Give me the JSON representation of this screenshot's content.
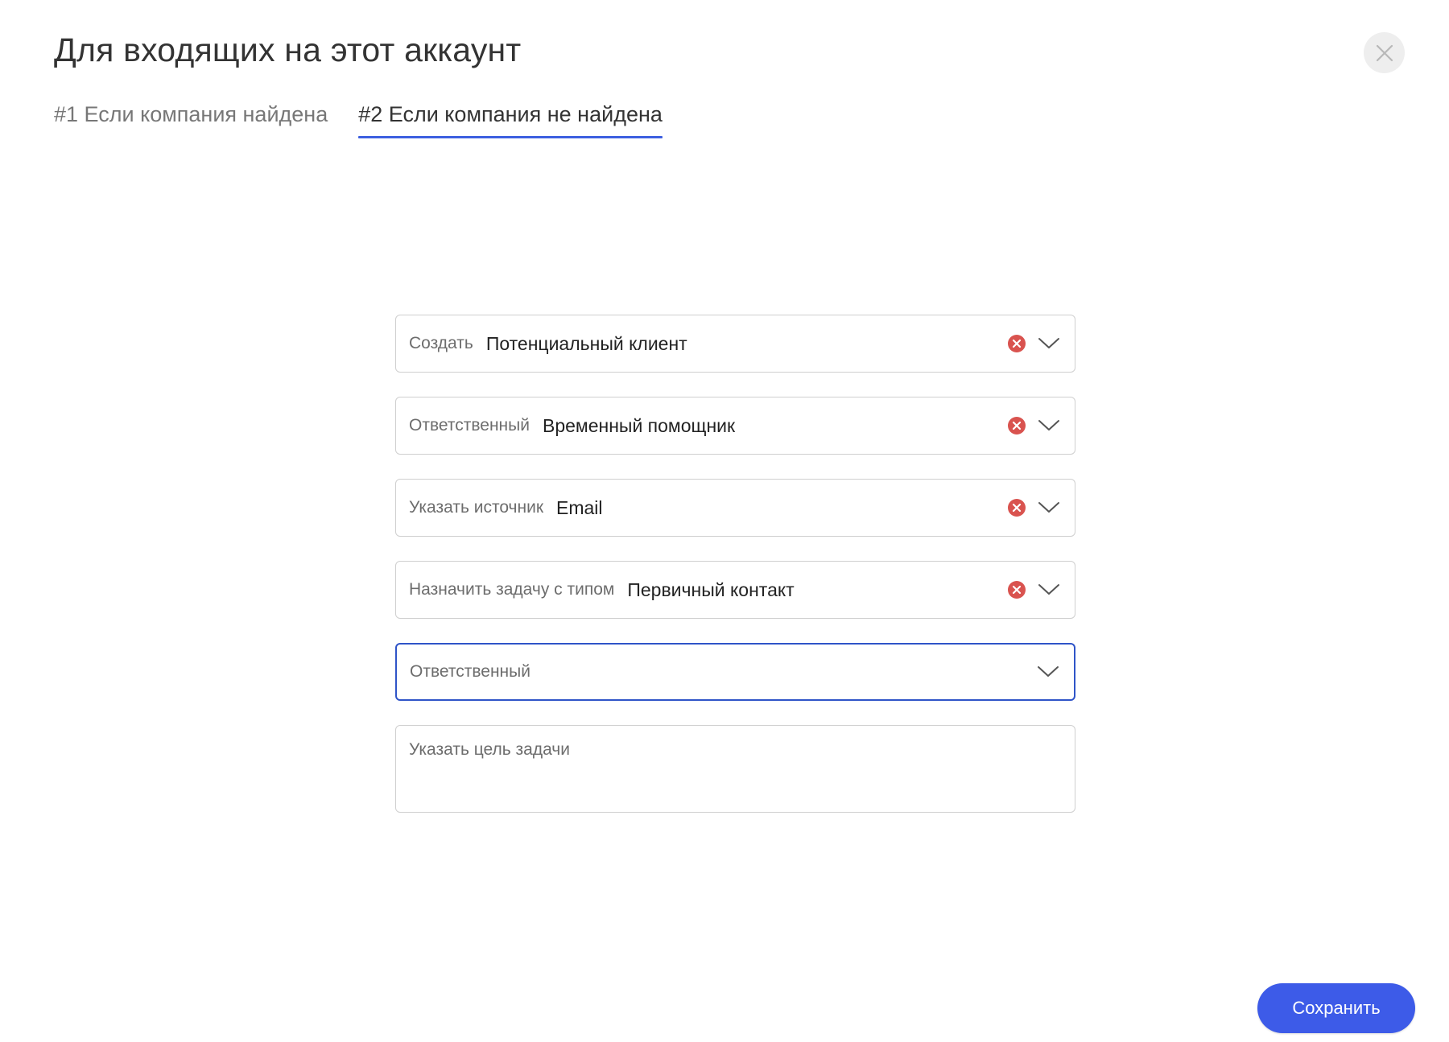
{
  "dialog": {
    "title": "Для входящих на этот аккаунт",
    "close_icon": "close-icon"
  },
  "tabs": [
    {
      "label": "#1 Если компания найдена",
      "active": false
    },
    {
      "label": "#2 Если компания не найдена",
      "active": true
    }
  ],
  "fields": [
    {
      "label": "Создать",
      "value": "Потенциальный клиент",
      "clearable": true
    },
    {
      "label": "Ответственный",
      "value": "Временный помощник",
      "clearable": true
    },
    {
      "label": "Указать источник",
      "value": "Email",
      "clearable": true
    },
    {
      "label": "Назначить задачу с типом",
      "value": "Первичный контакт",
      "clearable": true
    },
    {
      "label": "Ответственный",
      "value": "",
      "clearable": false,
      "focused": true
    }
  ],
  "task_goal": {
    "placeholder": "Указать цель задачи"
  },
  "footer": {
    "save_label": "Сохранить"
  },
  "colors": {
    "accent": "#3d5be8",
    "focus_border": "#2f54c8",
    "clear_icon": "#d9534f"
  }
}
